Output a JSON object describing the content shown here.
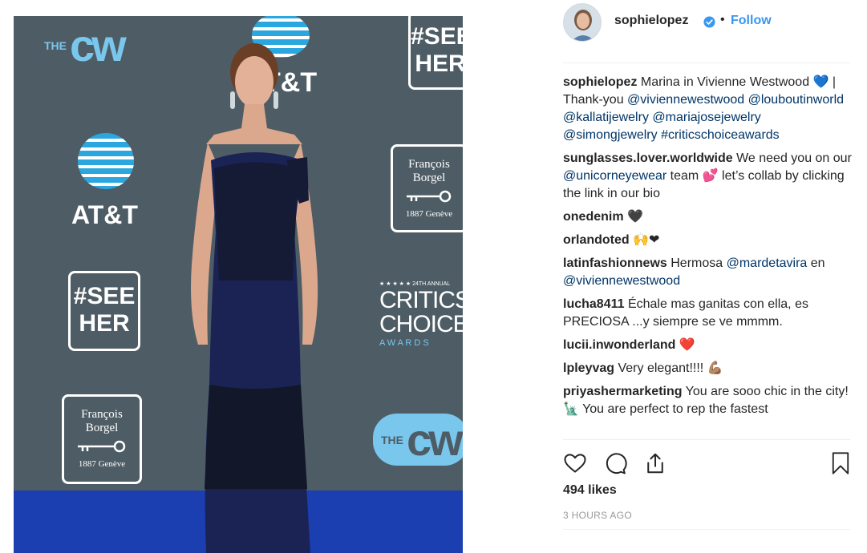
{
  "post": {
    "username": "sophielopez",
    "follow_label": "Follow",
    "separator": "•"
  },
  "photo": {
    "backdrop_color": "#4e5d65",
    "carpet_color": "#1b3fb0",
    "sponsor_marks": {
      "cw_small": "THE",
      "cw_big": "cw",
      "att": "AT&T",
      "see_her_line1": "#SEE",
      "see_her_line2": "HER",
      "fb_name": "François Borgel",
      "fb_year": "1887 Genève",
      "critics_stars": "★ ★ ★ ★ ★ 24TH ANNUAL",
      "critics_1": "CRITICS'",
      "critics_2": "CHOICE",
      "critics_3": "A W A R D S"
    }
  },
  "caption": {
    "user": "sophielopez",
    "text_1": "Marina in Vivienne Westwood",
    "emoji_1": "💙",
    "text_2": "| Thank-you",
    "mentions": [
      "@viviennewestwood",
      "@louboutinworld",
      "@kallatijewelry",
      "@mariajosejewelry",
      "@simongjewelry",
      "#criticschoiceawards"
    ]
  },
  "comments": [
    {
      "user": "sunglasses.lover.worldwide",
      "pre": "We need you on our",
      "mention": "@unicorneyewear",
      "post": "team 💕 let’s collab by clicking the link in our bio"
    },
    {
      "user": "onedenim",
      "pre": "🖤",
      "mention": "",
      "post": ""
    },
    {
      "user": "orlandoted",
      "pre": "🙌❤",
      "mention": "",
      "post": ""
    },
    {
      "user": "latinfashionnews",
      "pre": "Hermosa",
      "mention": "@mardetavira",
      "post": "en",
      "mention2": "@viviennewestwood"
    },
    {
      "user": "lucha8411",
      "pre": "Échale mas ganitas con ella, es PRECIOSA ...y siempre se ve mmmm.",
      "mention": "",
      "post": ""
    },
    {
      "user": "lucii.inwonderland",
      "pre": "❤️",
      "mention": "",
      "post": ""
    },
    {
      "user": "lpleyvag",
      "pre": "Very elegant!!!! 💪🏽",
      "mention": "",
      "post": ""
    },
    {
      "user": "priyashermarketing",
      "pre": "You are sooo chic in the city! 🗽 You are perfect to rep the fastest",
      "mention": "",
      "post": ""
    }
  ],
  "stats": {
    "likes": "494 likes",
    "time_ago": "3 HOURS AGO"
  },
  "icons": [
    "heart-icon",
    "comment-icon",
    "share-icon",
    "bookmark-icon",
    "verified-badge-icon"
  ],
  "colors": {
    "link": "#3897f0",
    "mention": "#003569",
    "text": "#262626",
    "muted": "#999999"
  }
}
